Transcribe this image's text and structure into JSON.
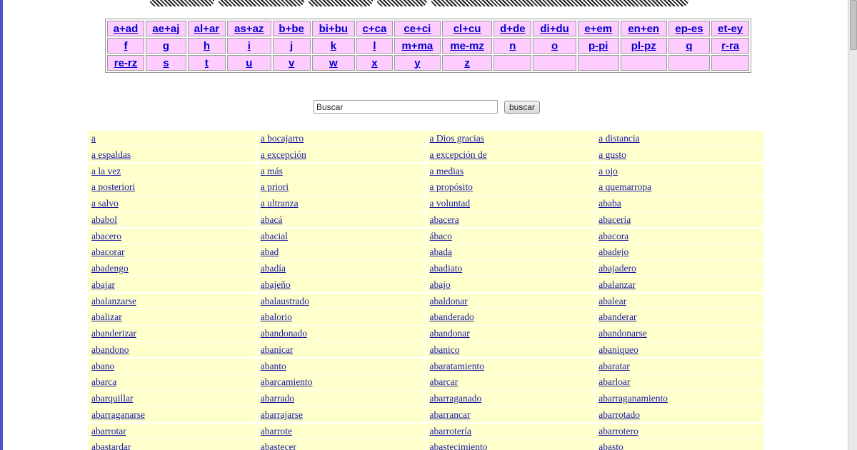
{
  "nav_rows": [
    [
      "a+ad",
      "ae+aj",
      "al+ar",
      "as+az",
      "b+be",
      "bi+bu",
      "c+ca",
      "ce+ci",
      "cl+cu",
      "d+de",
      "di+du",
      "e+em",
      "en+en",
      "ep-es",
      "et-ey"
    ],
    [
      "f",
      "g",
      "h",
      "i",
      "j",
      "k",
      "l",
      "m+ma",
      "me-mz",
      "n",
      "o",
      "p-pi",
      "pl-pz",
      "q",
      "r-ra"
    ],
    [
      "re-rz",
      "s",
      "t",
      "u",
      "v",
      "w",
      "x",
      "y",
      "z",
      "",
      "",
      "",
      "",
      "",
      ""
    ]
  ],
  "search": {
    "placeholder": "Buscar",
    "button_label": "buscar"
  },
  "words": [
    [
      "a",
      "a bocajarro",
      "a Dios gracias",
      "a distancia"
    ],
    [
      "a espaldas",
      "a excepción",
      "a excepción de",
      "a gusto"
    ],
    [
      "a la vez",
      "a más",
      "a medias",
      "a ojo"
    ],
    [
      "a posteriori",
      "a priori",
      "a propósito",
      "a quemarropa"
    ],
    [
      "a salvo",
      "a ultranza",
      "a voluntad",
      "ababa"
    ],
    [
      "ababol",
      "abacá",
      "abacera",
      "abacería"
    ],
    [
      "abacero",
      "abacial",
      "ábaco",
      "abacora"
    ],
    [
      "abacorar",
      "abad",
      "abada",
      "abadejo"
    ],
    [
      "abadengo",
      "abadía",
      "abadiato",
      "abajadero"
    ],
    [
      "abajar",
      "abajeño",
      "abajo",
      "abalanzar"
    ],
    [
      "abalanzarse",
      "abalaustrado",
      "abaldonar",
      "abalear"
    ],
    [
      "abalizar",
      "abalorio",
      "abanderado",
      "abanderar"
    ],
    [
      "abanderizar",
      "abandonado",
      "abandonar",
      "abandonarse"
    ],
    [
      "abandono",
      "abanicar",
      "abanico",
      "abaniqueo"
    ],
    [
      "abano",
      "abanto",
      "abaratamiento",
      "abaratar"
    ],
    [
      "abarca",
      "abarcamiento",
      "abarcar",
      "abarloar"
    ],
    [
      "abarquillar",
      "abarrado",
      "abarraganado",
      "abarraganamiento"
    ],
    [
      "abarraganarse",
      "abarrajarse",
      "abarrancar",
      "abarrotado"
    ],
    [
      "abarrotar",
      "abarrote",
      "abarrotería",
      "abarrotero"
    ],
    [
      "abastardar",
      "abastecer",
      "abastecimiento",
      "abasto"
    ]
  ]
}
